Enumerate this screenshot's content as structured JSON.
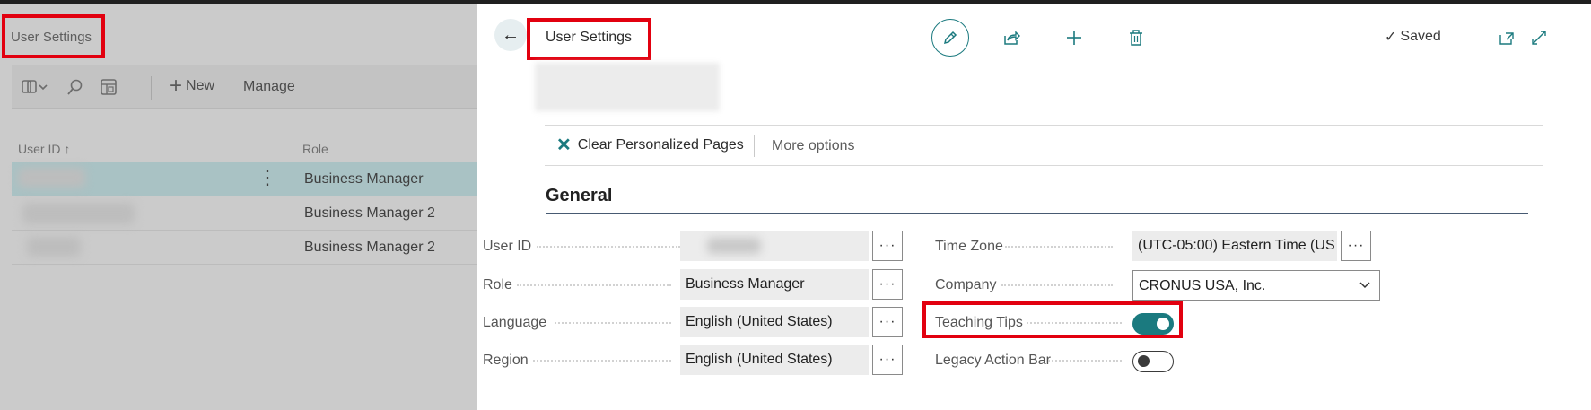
{
  "list_page": {
    "title": "User Settings",
    "toolbar": {
      "new_label": "New",
      "manage_label": "Manage"
    },
    "columns": {
      "user_id": "User ID",
      "sort_indicator": "↑",
      "role": "Role"
    },
    "rows": [
      {
        "role": "Business Manager",
        "selected": true
      },
      {
        "role": "Business Manager 2",
        "selected": false
      },
      {
        "role": "Business Manager 2",
        "selected": false
      }
    ]
  },
  "card": {
    "title": "User Settings",
    "back_icon": "←",
    "saved_check": "✓",
    "saved_label": "Saved",
    "action_bar": {
      "clear_icon": "✕",
      "clear_label": "Clear Personalized Pages",
      "more_label": "More options"
    },
    "section_title": "General",
    "fields": {
      "user_id_label": "User ID",
      "role_label": "Role",
      "role_value": "Business Manager",
      "language_label": "Language",
      "language_value": "English (United States)",
      "region_label": "Region",
      "region_value": "English (United States)",
      "time_zone_label": "Time Zone",
      "time_zone_value": "(UTC-05:00) Eastern Time (US ...",
      "company_label": "Company",
      "company_value": "CRONUS USA, Inc.",
      "teaching_tips_label": "Teaching Tips",
      "teaching_tips_on": true,
      "legacy_action_bar_label": "Legacy Action Bar",
      "legacy_action_bar_on": false
    },
    "ellipsis": "···"
  },
  "colors": {
    "accent": "#1b7a7f",
    "highlight_box": "#e2000f",
    "selected_row": "#a9c2c4"
  }
}
